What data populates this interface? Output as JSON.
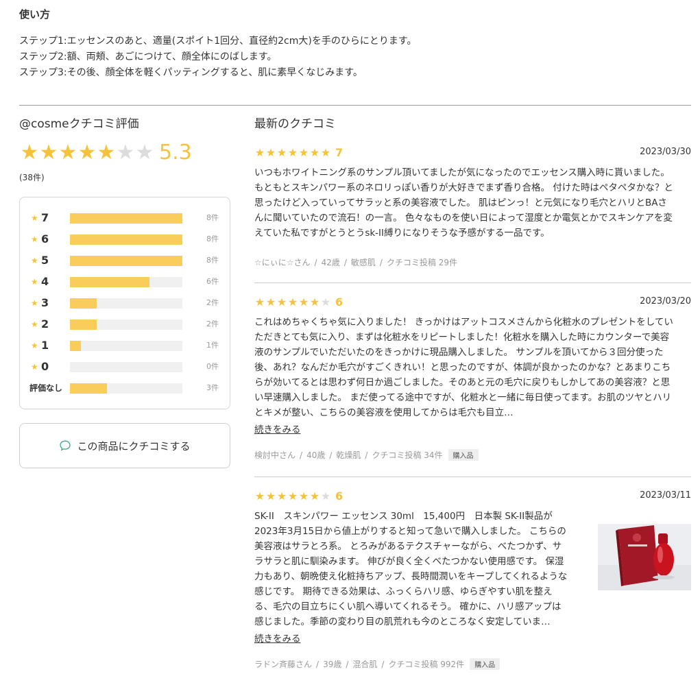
{
  "usage": {
    "title": "使い方",
    "steps": [
      "ステップ1:エッセンスのあと、適量(スポイト1回分、直径約2cm大)を手のひらにとります。",
      "ステップ2:額、両頬、あごにつけて、顔全体にのばします。",
      "ステップ3:その後、顔全体を軽くパッティングすると、肌に素早くなじみます。"
    ]
  },
  "rating": {
    "title": "@cosmeクチコミ評価",
    "average": "5.3",
    "stars_filled": 5,
    "stars_total": 7,
    "total_count": "(38件)",
    "distribution": [
      {
        "label": "7",
        "fraction": 1.0,
        "count": "8件"
      },
      {
        "label": "6",
        "fraction": 1.0,
        "count": "8件"
      },
      {
        "label": "5",
        "fraction": 1.0,
        "count": "8件"
      },
      {
        "label": "4",
        "fraction": 0.71,
        "count": "6件"
      },
      {
        "label": "3",
        "fraction": 0.24,
        "count": "2件"
      },
      {
        "label": "2",
        "fraction": 0.24,
        "count": "2件"
      },
      {
        "label": "1",
        "fraction": 0.1,
        "count": "1件"
      },
      {
        "label": "0",
        "fraction": 0.0,
        "count": "0件"
      },
      {
        "label": "評価なし",
        "fraction": 0.33,
        "count": "3件"
      }
    ],
    "review_button": "この商品にクチコミする"
  },
  "reviews_section": {
    "title": "最新のクチコミ",
    "more_label": "続きをみる",
    "reviews": [
      {
        "stars": 7,
        "score": "7",
        "date": "2023/03/30",
        "lines": [
          "いつもホワイトニング系のサンプル頂いてましたが気になったのでエッセンス購入時に貰いました。",
          "もともとスキンパワー系のネロリっぽい香りが大好きでまず香り合格。 付けた時はペタペタかな？と",
          "思ったけど入っていってサラッと系の美容液でした。 肌はピンっ！と元気になり毛穴とハリとBAさ",
          "んに聞いていたので流石！の一言。 色々なものを使い日によって湿度とか電気とかでスキンケアを変",
          "えていた私ですがとうとうsk-II縛りになりそうな予感がする一品です。"
        ],
        "user": "☆にぃに☆さん",
        "age": "42歳",
        "skin": "敏感肌",
        "posts": "クチコミ投稿 29件",
        "badge": ""
      },
      {
        "stars": 6,
        "score": "6",
        "date": "2023/03/20",
        "lines": [
          "これはめちゃくちゃ気に入りました！ きっかけはアットコスメさんから化粧水のプレゼントをしてい",
          "ただきとても気に入り、まずは化粧水をリピートしました！化粧水を購入した時にカウンターで美容",
          "液のサンプルでいただいたのをきっかけに現品購入しました。 サンプルを頂いてから３回分使った",
          "後、あれ？なんだか毛穴がすごくきれい！と思ったのですが、体調が良かったのかな？とあまりこち",
          "らが効いてるとは思わず何日か過ごしました。そのあと元の毛穴に戻りもしかしてあの美容液？と思",
          "い早速購入しました。 まだ使ってる途中ですが、化粧水と一緒に毎日使ってます。お肌のツヤとハリ",
          "とキメが整い、こちらの美容液を使用してからは毛穴も目立…"
        ],
        "user": "検討中さん",
        "age": "40歳",
        "skin": "乾燥肌",
        "posts": "クチコミ投稿 34件",
        "badge": "購入品"
      },
      {
        "stars": 6,
        "score": "6",
        "date": "2023/03/11",
        "lines": [
          "SK-II　スキンパワー エッセンス 30ml　15,400円　日本製  SK-II製品が",
          "2023年3月15日から値上がりすると知って急いで購入しました。 こちらの",
          "美容液はサラとろ系。 とろみがあるテクスチャーながら、べたつかず、サ",
          "ラサラと肌に馴染みます。 伸びが良く全くべたつかない使用感です。 保湿",
          "力もあり、朝晩使え化粧持ちアップ、長時間潤いをキープしてくれるような",
          "感じです。 期待できる効果は、ふっくらハリ感、ゆらぎやすい肌を整え",
          "る、毛穴の目立ちにくい肌へ導いてくれるそう。 確かに、ハリ感アップは",
          "感じました。季節の変わり目の肌荒れも今のところなく安定していま…"
        ],
        "user": "ラドン斉藤さん",
        "age": "39歳",
        "skin": "混合肌",
        "posts": "クチコミ投稿 992件",
        "badge": "購入品"
      }
    ]
  },
  "colors": {
    "star": "#f5c33b",
    "star_off": "#dcdcdc",
    "bar": "#f9cd5b",
    "bar_bg": "#f0f0f0"
  }
}
